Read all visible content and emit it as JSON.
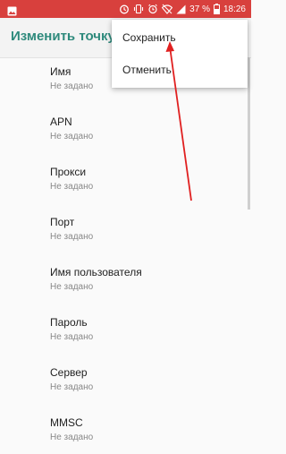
{
  "status_bar": {
    "battery_percent": "37 %",
    "time": "18:26",
    "icons": [
      "image-icon",
      "alarm-clock-icon",
      "vibrate-icon",
      "alarm-icon",
      "wifi-off-icon",
      "signal-icon",
      "battery-icon"
    ],
    "background_color": "#d8403d"
  },
  "app_bar": {
    "title": "Изменить точку",
    "title_color": "#2e8a7c"
  },
  "fields": [
    {
      "label": "Имя",
      "value": "Не задано"
    },
    {
      "label": "APN",
      "value": "Не задано"
    },
    {
      "label": "Прокси",
      "value": "Не задано"
    },
    {
      "label": "Порт",
      "value": "Не задано"
    },
    {
      "label": "Имя пользователя",
      "value": "Не задано"
    },
    {
      "label": "Пароль",
      "value": "Не задано"
    },
    {
      "label": "Сервер",
      "value": "Не задано"
    },
    {
      "label": "MMSC",
      "value": "Не задано"
    }
  ],
  "overflow_menu": {
    "items": [
      {
        "label": "Сохранить"
      },
      {
        "label": "Отменить"
      }
    ]
  },
  "annotation": {
    "type": "arrow",
    "color": "#e02020",
    "points_to": "Сохранить"
  }
}
